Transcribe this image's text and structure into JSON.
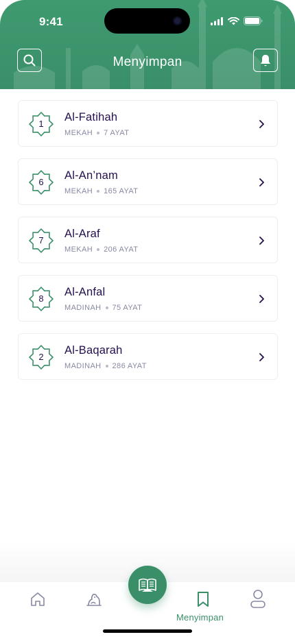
{
  "status_bar": {
    "time": "9:41"
  },
  "header": {
    "title": "Menyimpan"
  },
  "colors": {
    "primary": "#3a8f68",
    "title_text": "#240f4f",
    "meta_text": "#8789a3"
  },
  "surahs": [
    {
      "number": "1",
      "name": "Al-Fatihah",
      "place": "MEKAH",
      "verses": "7 AYAT"
    },
    {
      "number": "6",
      "name": "Al-An’nam",
      "place": "MEKAH",
      "verses": "165 AYAT"
    },
    {
      "number": "7",
      "name": "Al-Araf",
      "place": "MEKAH",
      "verses": "206 AYAT"
    },
    {
      "number": "8",
      "name": "Al-Anfal",
      "place": "MADINAH",
      "verses": "75 AYAT"
    },
    {
      "number": "2",
      "name": "Al-Baqarah",
      "place": "MADINAH",
      "verses": "286 AYAT"
    }
  ],
  "nav": {
    "active_label": "Menyimpan"
  }
}
